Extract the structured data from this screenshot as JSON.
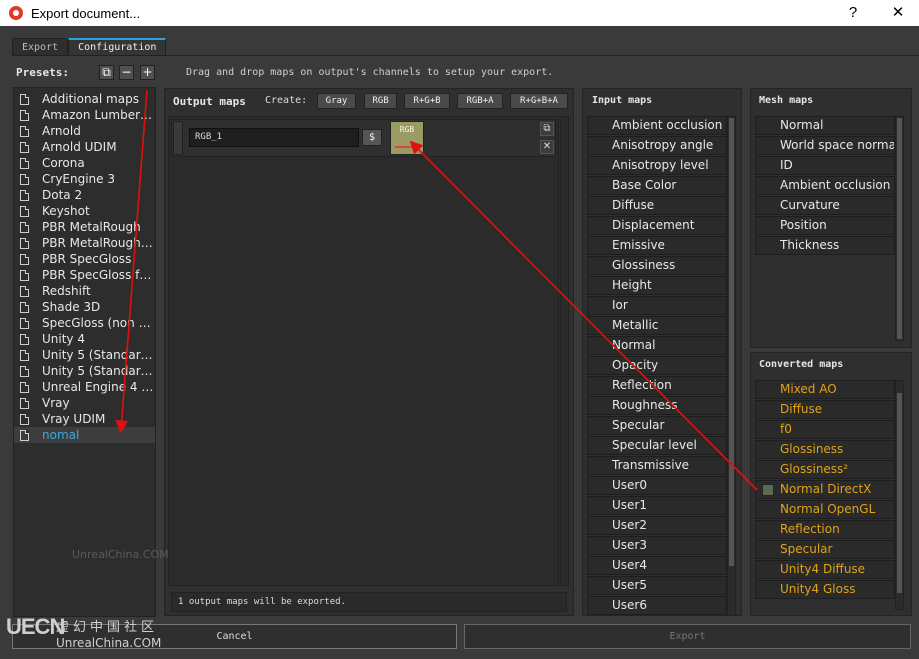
{
  "window": {
    "title": "Export document...",
    "help": "?",
    "close": "✕"
  },
  "tabs": [
    {
      "label": "Export"
    },
    {
      "label": "Configuration"
    }
  ],
  "presets": {
    "label": "Presets:",
    "buttons": {
      "duplicate": "⧉",
      "remove": "−",
      "add": "+"
    },
    "items": [
      "Additional maps",
      "Amazon Lumbery...",
      "Arnold",
      "Arnold UDIM",
      "Corona",
      "CryEngine 3",
      "Dota 2",
      "Keyshot",
      "PBR MetalRough",
      "PBR MetalRough (...",
      "PBR SpecGloss",
      "PBR SpecGloss fro...",
      "Redshift",
      "Shade 3D",
      "SpecGloss (non P...",
      "Unity 4",
      "Unity 5 (Standard ...",
      "Unity 5 (Standard ...",
      "Unreal Engine 4 (P...",
      "Vray",
      "Vray UDIM",
      "nomal"
    ],
    "selected_index": 21
  },
  "hint": "Drag and drop maps on output's channels to setup your export.",
  "output_maps": {
    "label": "Output maps",
    "create_label": "Create:",
    "create_buttons": [
      "Gray",
      "RGB",
      "R+G+B",
      "RGB+A",
      "R+G+B+A"
    ],
    "map_name": "RGB_1",
    "dollar": "$",
    "channel_label": "RGB",
    "status": "1 output maps will be exported."
  },
  "input_maps": {
    "label": "Input maps",
    "items": [
      "Ambient occlusion",
      "Anisotropy angle",
      "Anisotropy level",
      "Base Color",
      "Diffuse",
      "Displacement",
      "Emissive",
      "Glossiness",
      "Height",
      "Ior",
      "Metallic",
      "Normal",
      "Opacity",
      "Reflection",
      "Roughness",
      "Specular",
      "Specular level",
      "Transmissive",
      "User0",
      "User1",
      "User2",
      "User3",
      "User4",
      "User5",
      "User6"
    ]
  },
  "mesh_maps": {
    "label": "Mesh maps",
    "items": [
      "Normal",
      "World space normal",
      "ID",
      "Ambient occlusion",
      "Curvature",
      "Position",
      "Thickness"
    ]
  },
  "converted_maps": {
    "label": "Converted maps",
    "items": [
      "Mixed AO",
      "Diffuse",
      "f0",
      "Glossiness",
      "Glossiness²",
      "Normal DirectX",
      "Normal OpenGL",
      "Reflection",
      "Specular",
      "Unity4 Diffuse",
      "Unity4 Gloss"
    ],
    "checked_index": 5,
    "color": "#e0a21a"
  },
  "footer": {
    "cancel": "Cancel",
    "export": "Export"
  },
  "watermark": {
    "center": "UnrealChina.COM",
    "logo": "UECN",
    "cn": "虚幻中国社区",
    "en": "UnrealChina.COM"
  },
  "colors": {
    "accent": "#2aa3d8",
    "annotation_arrow": "#e01010",
    "selected_preset_text": "#3aa9e0"
  }
}
